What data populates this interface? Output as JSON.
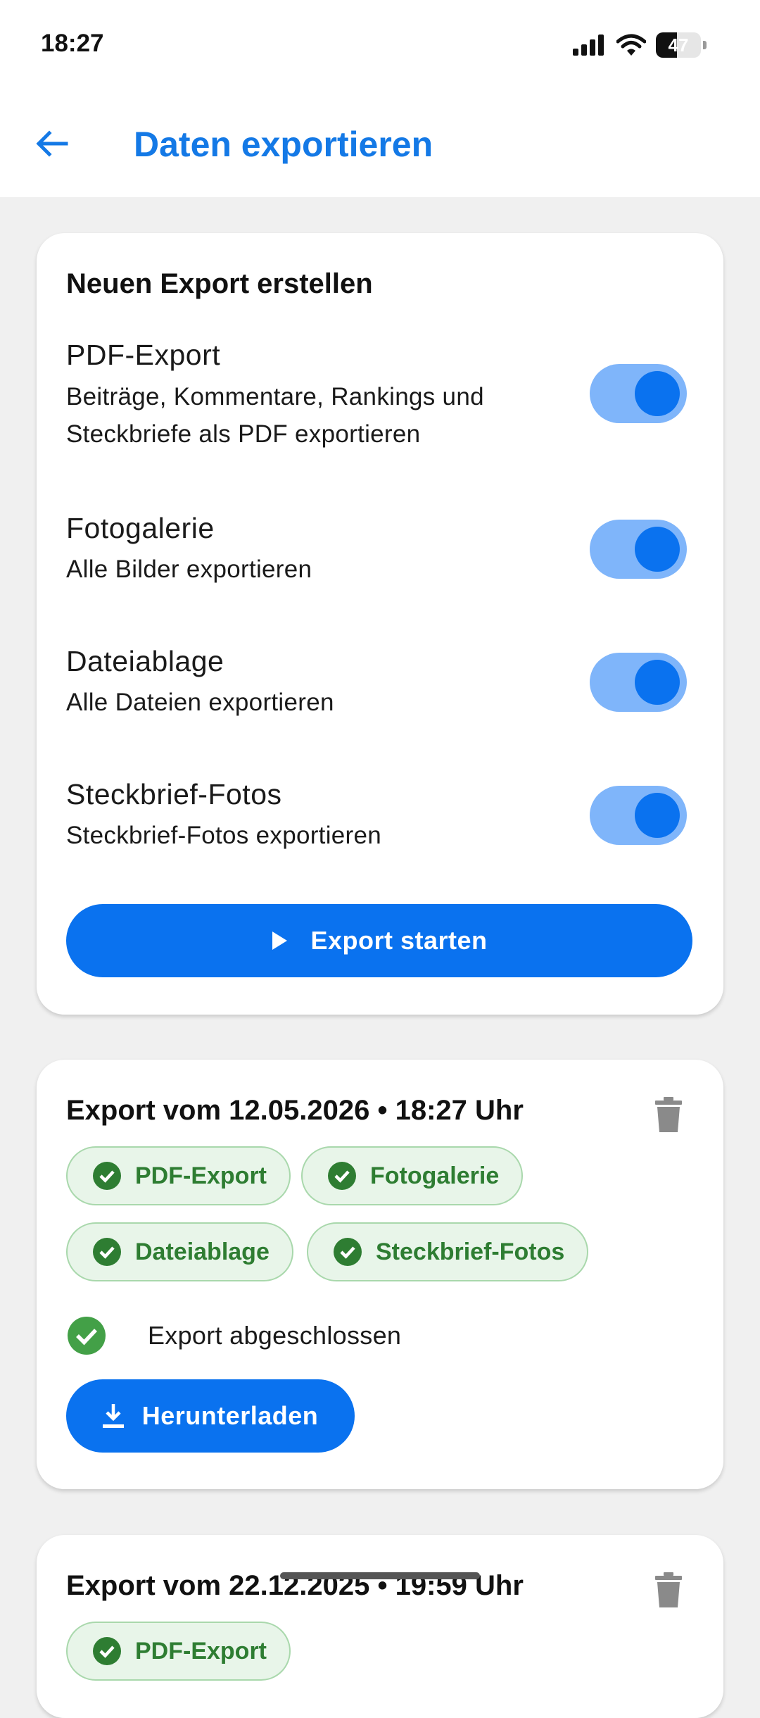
{
  "status_bar": {
    "time": "18:27",
    "battery": "47",
    "battery_level": 0.47
  },
  "app_bar": {
    "title": "Daten exportieren"
  },
  "new_export": {
    "title": "Neuen Export erstellen",
    "options": [
      {
        "title": "PDF-Export",
        "description_lines": [
          "Beiträge, Kommentare, Rankings und",
          "Steckbriefe als PDF exportieren"
        ],
        "enabled": true
      },
      {
        "title": "Fotogalerie",
        "description_lines": [
          "Alle Bilder exportieren"
        ],
        "enabled": true
      },
      {
        "title": "Dateiablage",
        "description_lines": [
          "Alle Dateien exportieren"
        ],
        "enabled": true
      },
      {
        "title": "Steckbrief-Fotos",
        "description_lines": [
          "Steckbrief-Fotos exportieren"
        ],
        "enabled": true
      }
    ],
    "start_label": "Export starten"
  },
  "exports": [
    {
      "title": "Export vom 12.05.2026 • 18:27 Uhr",
      "chips": [
        "PDF-Export",
        "Fotogalerie",
        "Dateiablage",
        "Steckbrief-Fotos"
      ],
      "status": "Export abgeschlossen",
      "download_label": "Herunterladen"
    },
    {
      "title": "Export vom 22.12.2025 • 19:59 Uhr",
      "chips": [
        "PDF-Export"
      ]
    }
  ],
  "colors": {
    "accent": "#0a72ef",
    "title_blue": "#1479e6",
    "toggle_track": "#7fb5fa",
    "chip_bg": "#e8f5e9",
    "chip_border": "#a9d8ac",
    "chip_text": "#2e7d32",
    "success": "#43a047",
    "background": "#f0f0f0"
  }
}
